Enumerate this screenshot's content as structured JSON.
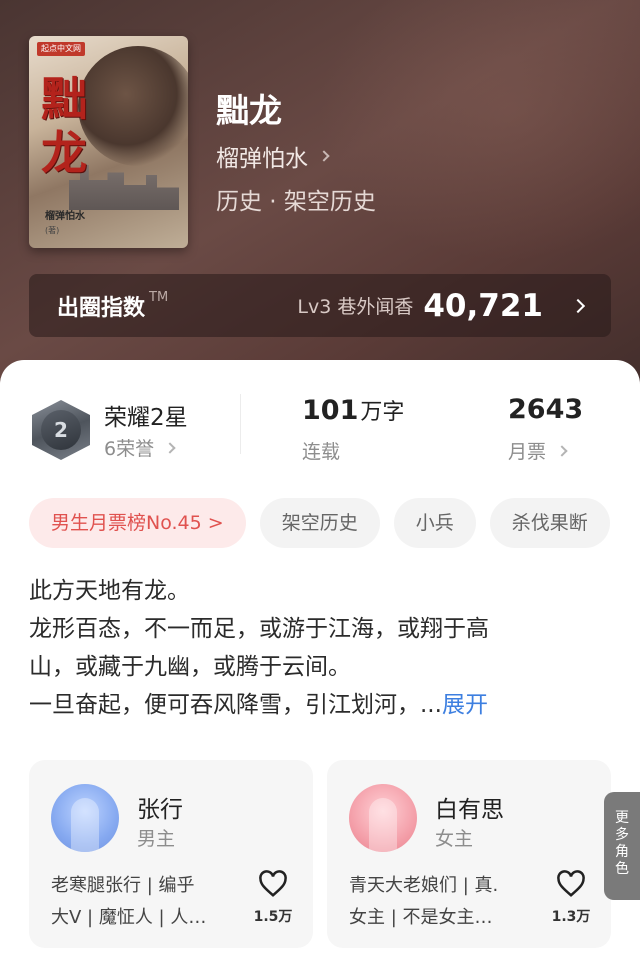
{
  "book": {
    "title": "黜龙",
    "author": "榴弹怕水",
    "genre": "历史 · 架空历史",
    "cover": {
      "publisher": "起点中文网",
      "title_text": "黜龙",
      "author_text": "榴弹怕水",
      "mark": "(著)"
    }
  },
  "index_bar": {
    "label": "出圈指数",
    "tm": "TM",
    "level_text": "Lv3 巷外闻香",
    "value": "40,721"
  },
  "stats": {
    "rank_title": "荣耀2星",
    "rank_sub": "6荣誉",
    "medal_number": "2",
    "words_value": "101",
    "words_unit": "万字",
    "words_label": "连载",
    "ticket_value": "2643",
    "ticket_label": "月票"
  },
  "tags": [
    "男生月票榜No.45 >",
    "架空历史",
    "小兵",
    "杀伐果断"
  ],
  "description": {
    "lines": [
      "此方天地有龙。",
      "龙形百态，不一而足，或游于江海，或翔于高",
      "山，或藏于九幽，或腾于云间。",
      "一旦奋起，便可吞风降雪，引江划河，..."
    ],
    "expand_label": "展开"
  },
  "characters": [
    {
      "name": "张行",
      "role": "男主",
      "desc_lines": [
        "老寒腿张行 | 编乎",
        "大V | 魔怔人 | 人…"
      ],
      "likes": "1.5万",
      "avatar_color": "#86a9f0"
    },
    {
      "name": "白有思",
      "role": "女主",
      "desc_lines": [
        "青天大老娘们 | 真.",
        "女主 | 不是女主…"
      ],
      "likes": "1.3万",
      "avatar_color": "#f4a0aa"
    }
  ],
  "more_tab": {
    "label_chars": [
      "更",
      "多",
      "角",
      "色"
    ]
  },
  "colors": {
    "accent_red": "#e0524f",
    "link_blue": "#3d7fe0"
  }
}
